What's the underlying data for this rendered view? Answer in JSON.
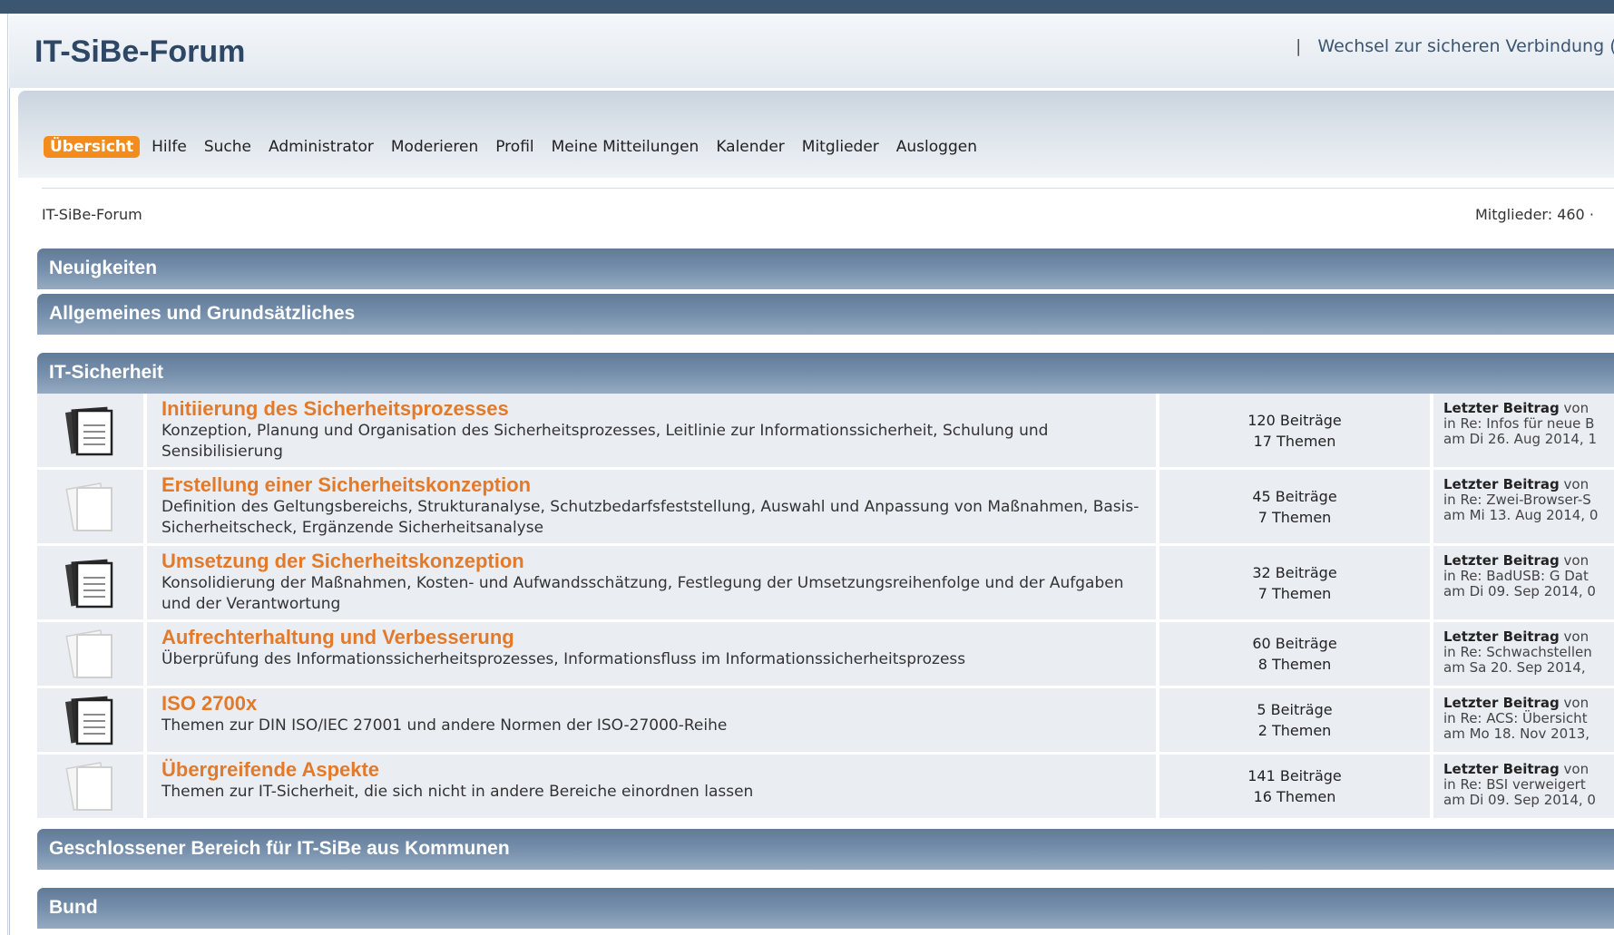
{
  "site": {
    "title": "IT-SiBe-Forum",
    "secure_separator": "|",
    "secure_link": "Wechsel zur sicheren Verbindung ("
  },
  "menu": {
    "items": [
      "Übersicht",
      "Hilfe",
      "Suche",
      "Administrator",
      "Moderieren",
      "Profil",
      "Meine Mitteilungen",
      "Kalender",
      "Mitglieder",
      "Ausloggen"
    ],
    "active_index": 0
  },
  "breadcrumb": "IT-SiBe-Forum",
  "stats": {
    "members": "Mitglieder: 460 ·"
  },
  "categories": [
    {
      "name": "Neuigkeiten"
    },
    {
      "name": "Allgemeines und Grundsätzliches"
    },
    {
      "name": "IT-Sicherheit",
      "boards": [
        {
          "title": "Initiierung des Sicherheitsprozesses",
          "desc": "Konzeption, Planung und Organisation des Sicherheitsprozesses, Leitlinie zur Informationssicherheit, Schulung und Sensibilisierung",
          "posts": "120 Beiträge",
          "topics": "17 Themen",
          "last_label": "Letzter Beitrag",
          "last_by": " von",
          "last_in": "in Re: Infos für neue B",
          "last_date": "am Di 26. Aug 2014, 1",
          "icon": "board-new-posts-icon"
        },
        {
          "title": "Erstellung einer Sicherheitskonzeption",
          "desc": "Definition des Geltungsbereichs, Strukturanalyse, Schutzbedarfsfeststellung, Auswahl und Anpassung von Maßnahmen, Basis-Sicherheitscheck, Ergänzende Sicherheitsanalyse",
          "posts": "45 Beiträge",
          "topics": "7 Themen",
          "last_label": "Letzter Beitrag",
          "last_by": " von",
          "last_in": "in Re: Zwei-Browser-S",
          "last_date": "am Mi 13. Aug 2014, 0",
          "icon": "board-no-new-posts-icon"
        },
        {
          "title": "Umsetzung der Sicherheitskonzeption",
          "desc": "Konsolidierung der Maßnahmen, Kosten- und Aufwandsschätzung, Festlegung der Umsetzungsreihenfolge und der Aufgaben und der Verantwortung",
          "posts": "32 Beiträge",
          "topics": "7 Themen",
          "last_label": "Letzter Beitrag",
          "last_by": " von",
          "last_in": "in Re: BadUSB: G Dat",
          "last_date": "am Di 09. Sep 2014, 0",
          "icon": "board-new-posts-icon"
        },
        {
          "title": "Aufrechterhaltung und Verbesserung",
          "desc": "Überprüfung des Informationssicherheitsprozesses, Informationsfluss im Informationssicherheitsprozess",
          "posts": "60 Beiträge",
          "topics": "8 Themen",
          "last_label": "Letzter Beitrag",
          "last_by": " von",
          "last_in": "in Re: Schwachstellen",
          "last_date": "am Sa 20. Sep 2014,",
          "icon": "board-no-new-posts-icon"
        },
        {
          "title": "ISO 2700x",
          "desc": "Themen zur DIN ISO/IEC 27001 und andere Normen der ISO-27000-Reihe",
          "posts": "5 Beiträge",
          "topics": "2 Themen",
          "last_label": "Letzter Beitrag",
          "last_by": " von",
          "last_in": "in Re: ACS: Übersicht",
          "last_date": "am Mo 18. Nov 2013,",
          "icon": "board-new-posts-icon"
        },
        {
          "title": "Übergreifende Aspekte",
          "desc": "Themen zur IT-Sicherheit, die sich nicht in andere Bereiche einordnen lassen",
          "posts": "141 Beiträge",
          "topics": "16 Themen",
          "last_label": "Letzter Beitrag",
          "last_by": " von",
          "last_in": "in Re: BSI verweigert",
          "last_date": "am Di 09. Sep 2014, 0",
          "icon": "board-no-new-posts-icon"
        }
      ]
    },
    {
      "name": "Geschlossener Bereich für IT-SiBe aus Kommunen"
    },
    {
      "name": "Bund"
    }
  ],
  "colors": {
    "title": "#2d4765",
    "accent": "#f28c1c",
    "board_title": "#e27a2a",
    "category_bar": "#6f89a6"
  }
}
